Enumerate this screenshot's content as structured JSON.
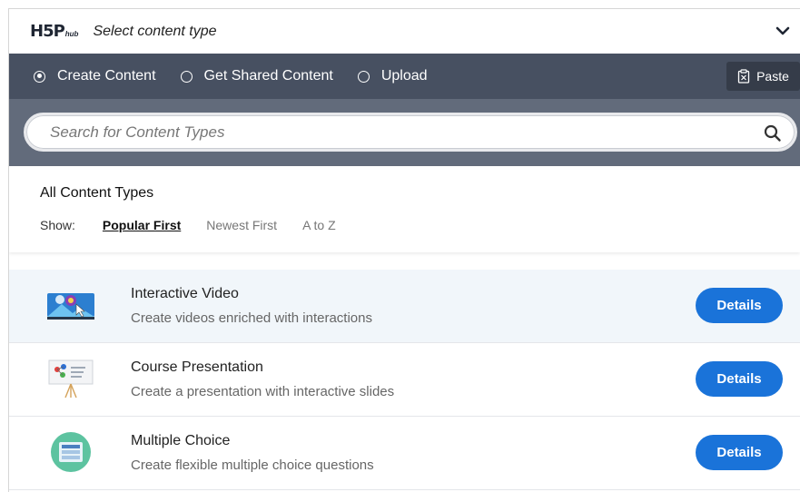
{
  "header": {
    "logo_main": "H5P",
    "logo_sub": "hub",
    "title": "Select content type"
  },
  "tabs": [
    {
      "label": "Create Content",
      "selected": true
    },
    {
      "label": "Get Shared Content",
      "selected": false
    },
    {
      "label": "Upload",
      "selected": false
    }
  ],
  "paste": {
    "label": "Paste"
  },
  "search": {
    "placeholder": "Search for Content Types"
  },
  "filters": {
    "title": "All Content Types",
    "show_label": "Show:",
    "options": [
      {
        "label": "Popular First",
        "active": true
      },
      {
        "label": "Newest First",
        "active": false
      },
      {
        "label": "A to Z",
        "active": false
      }
    ]
  },
  "items": [
    {
      "title": "Interactive Video",
      "description": "Create videos enriched with interactions",
      "button": "Details",
      "icon": "interactive-video-icon"
    },
    {
      "title": "Course Presentation",
      "description": "Create a presentation with interactive slides",
      "button": "Details",
      "icon": "course-presentation-icon"
    },
    {
      "title": "Multiple Choice",
      "description": "Create flexible multiple choice questions",
      "button": "Details",
      "icon": "multiple-choice-icon"
    }
  ],
  "colors": {
    "tabbar": "#475061",
    "search_area": "#626b7b",
    "accent": "#1a73d9"
  }
}
